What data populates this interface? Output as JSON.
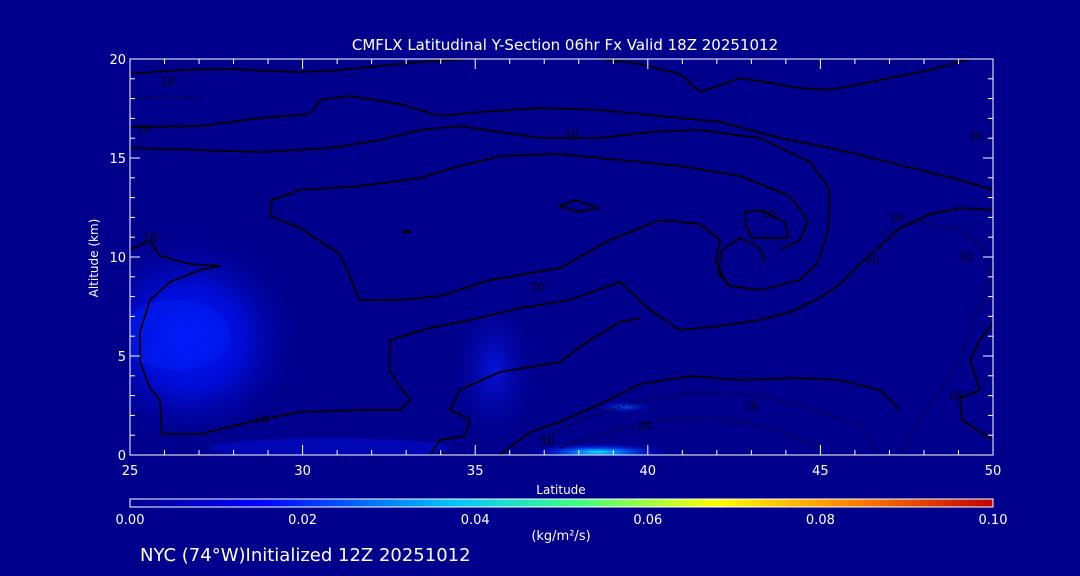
{
  "chart_data": {
    "type": "heatmap",
    "title": "CMFLX Latitudinal Y-Section 06hr  Fx Valid 18Z 20251012",
    "xlabel": "Latitude",
    "ylabel": "Altitude (km)",
    "xlim": [
      25,
      50
    ],
    "ylim": [
      0,
      20
    ],
    "x_ticks": [
      "25",
      "30",
      "35",
      "40",
      "45",
      "50"
    ],
    "y_ticks": [
      "0",
      "5",
      "10",
      "15",
      "20"
    ],
    "colorbar": {
      "range": [
        0.0,
        0.1
      ],
      "ticks": [
        "0.00",
        "0.02",
        "0.04",
        "0.06",
        "0.08",
        "0.10"
      ],
      "unit_label": "(kg/m²/s)",
      "colors": [
        "#00008d",
        "#0000ff",
        "#00c8ff",
        "#40ff80",
        "#ffff00",
        "#ff8000",
        "#c00000"
      ]
    },
    "flux_cells": [
      {
        "lat": 27.5,
        "alt": 6.0,
        "value": 0.012
      },
      {
        "lat": 35.5,
        "alt": 4.0,
        "value": 0.008
      },
      {
        "lat": 38.8,
        "alt": 0.2,
        "value": 0.04
      },
      {
        "lat": 39.2,
        "alt": 2.5,
        "value": 0.02
      }
    ],
    "contour_labels": [
      {
        "text": "10",
        "lat": 26.1,
        "alt": 18.9
      },
      {
        "text": "10",
        "lat": 25.4,
        "alt": 16.5
      },
      {
        "text": "10",
        "lat": 37.8,
        "alt": 16.2
      },
      {
        "text": "10",
        "lat": 49.5,
        "alt": 16.1
      },
      {
        "text": "10",
        "lat": 25.6,
        "alt": 11.0
      },
      {
        "text": "10",
        "lat": 43.5,
        "alt": 12.2
      },
      {
        "text": "10",
        "lat": 47.2,
        "alt": 12.0
      },
      {
        "text": "10",
        "lat": 46.5,
        "alt": 9.9
      },
      {
        "text": "10",
        "lat": 49.2,
        "alt": 10.0
      },
      {
        "text": "10",
        "lat": 36.8,
        "alt": 8.5
      },
      {
        "text": "10",
        "lat": 28.8,
        "alt": 1.8
      },
      {
        "text": "10",
        "lat": 43.0,
        "alt": 2.5
      },
      {
        "text": "20",
        "lat": 39.9,
        "alt": 1.5
      },
      {
        "text": "10",
        "lat": 37.1,
        "alt": 0.7
      },
      {
        "text": "10",
        "lat": 48.9,
        "alt": 3.0
      }
    ]
  },
  "footer": {
    "location": "NYC (74°W)Initialized 12Z 20251012"
  }
}
